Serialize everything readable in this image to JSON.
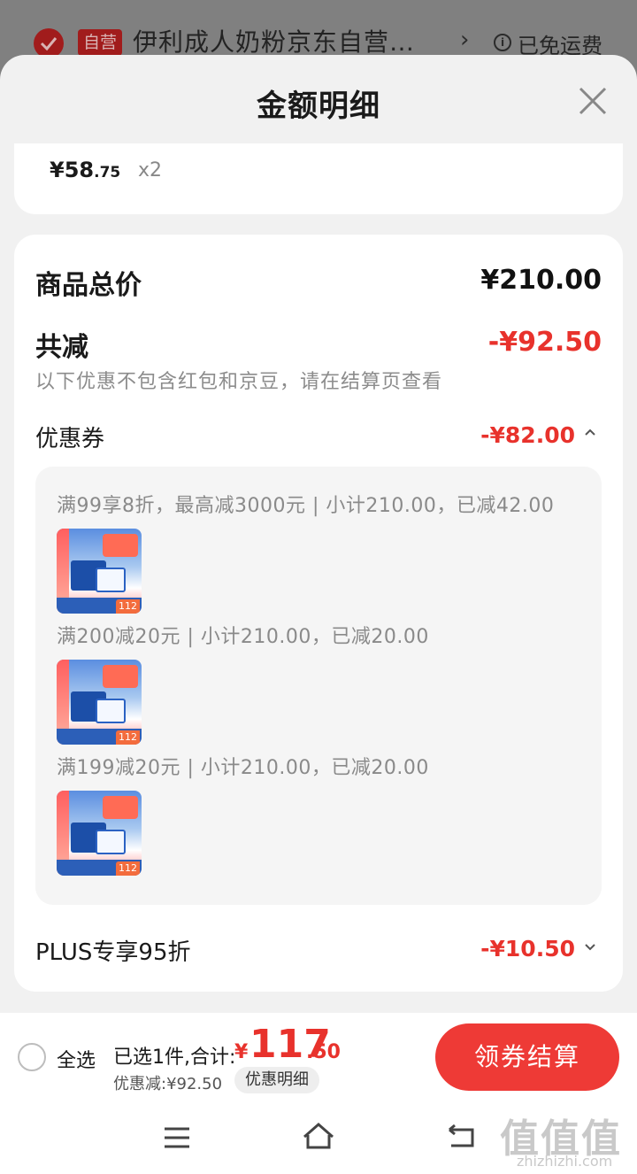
{
  "background_page": {
    "badge": "自营",
    "title": "伊利成人奶粉京东自营…",
    "shipping": "已免运费",
    "info_glyph": "i"
  },
  "sheet": {
    "title": "金额明细",
    "unit_price_int": "¥58",
    "unit_price_dec": ".75",
    "quantity": "x2"
  },
  "summary": {
    "total_label": "商品总价",
    "total_value": "¥210.00",
    "reduce_label": "共减",
    "reduce_value": "-¥92.50",
    "note": "以下优惠不包含红包和京豆，请在结算页查看"
  },
  "coupons": {
    "label": "优惠券",
    "value": "-¥82.00",
    "rules": [
      {
        "text": "满99享8折，最高减3000元 | 小计210.00，已减42.00",
        "thumb_badge": "112"
      },
      {
        "text": "满200减20元 | 小计210.00，已减20.00",
        "thumb_badge": "112"
      },
      {
        "text": "满199减20元 | 小计210.00，已减20.00",
        "thumb_badge": "112"
      }
    ]
  },
  "plus": {
    "label": "PLUS专享95折",
    "value": "-¥10.50"
  },
  "bottom_bar": {
    "select_all": "全选",
    "selected": "已选1件,合计:",
    "total_yen": "¥",
    "total_int": "117",
    "total_dec": ".50",
    "discount": "优惠减:¥92.50",
    "detail_button": "优惠明细",
    "checkout_button": "领券结算"
  },
  "watermark": {
    "big": "值值值",
    "small": "zhizhizhi.com"
  },
  "colors": {
    "accent_red": "#e8322c",
    "button_red": "#ee3a36"
  }
}
